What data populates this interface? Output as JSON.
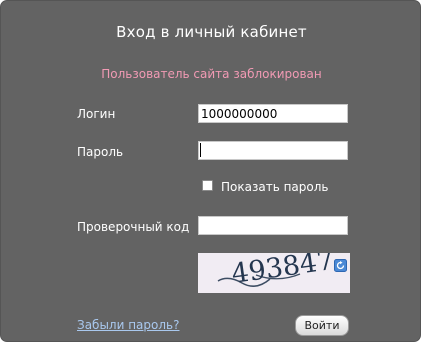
{
  "form": {
    "title": "Вход в личный кабинет",
    "error_message": "Пользователь сайта заблокирован",
    "login_label": "Логин",
    "login_value": "1000000000",
    "password_label": "Пароль",
    "password_value": "",
    "show_password_label": "Показать пароль",
    "show_password_checked": false,
    "captcha_label": "Проверочный код",
    "captcha_value": "",
    "captcha_text": "493847",
    "refresh_icon": "refresh-icon",
    "forgot_password_link": "Забыли пароль?",
    "submit_label": "Войти"
  },
  "colors": {
    "panel_bg": "#636363",
    "error_text": "#f19ab4",
    "link_text": "#a9c8ee"
  }
}
